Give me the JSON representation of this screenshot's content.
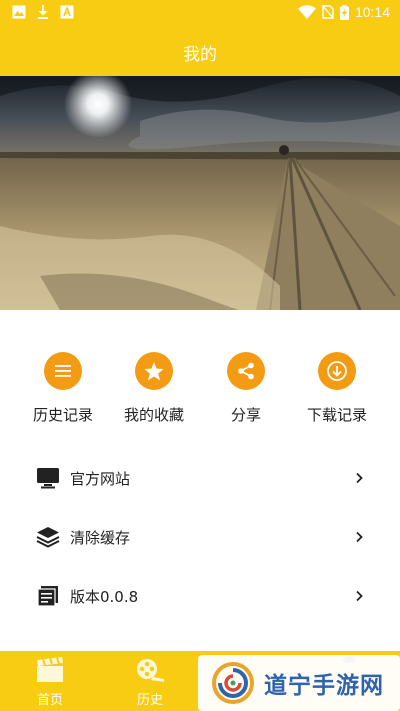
{
  "status_bar": {
    "time": "10:14",
    "left_icons": [
      "image-icon",
      "download-icon",
      "text-a-icon"
    ],
    "right_icons": [
      "wifi-icon",
      "no-sim-icon",
      "battery-charging-icon"
    ]
  },
  "header": {
    "title": "我的"
  },
  "banner": {
    "image": "desert-road-landscape"
  },
  "quick_actions": [
    {
      "label": "历史记录",
      "icon": "list-icon"
    },
    {
      "label": "我的收藏",
      "icon": "star-icon"
    },
    {
      "label": "分享",
      "icon": "share-icon"
    },
    {
      "label": "下载记录",
      "icon": "download-arrow-icon"
    }
  ],
  "menu": [
    {
      "label": "官方网站",
      "icon": "monitor-icon"
    },
    {
      "label": "清除缓存",
      "icon": "layers-icon"
    },
    {
      "label": "版本0.0.8",
      "icon": "document-icon"
    }
  ],
  "bottom_nav": [
    {
      "label": "首页",
      "icon": "clapperboard-icon"
    },
    {
      "label": "历史",
      "icon": "film-reel-icon"
    }
  ],
  "watermark": {
    "text": "道宁手游网"
  },
  "colors": {
    "brand_yellow": "#f7cc12",
    "accent_orange": "#f39b12",
    "watermark_blue": "#2f63ad",
    "text": "#222222"
  }
}
